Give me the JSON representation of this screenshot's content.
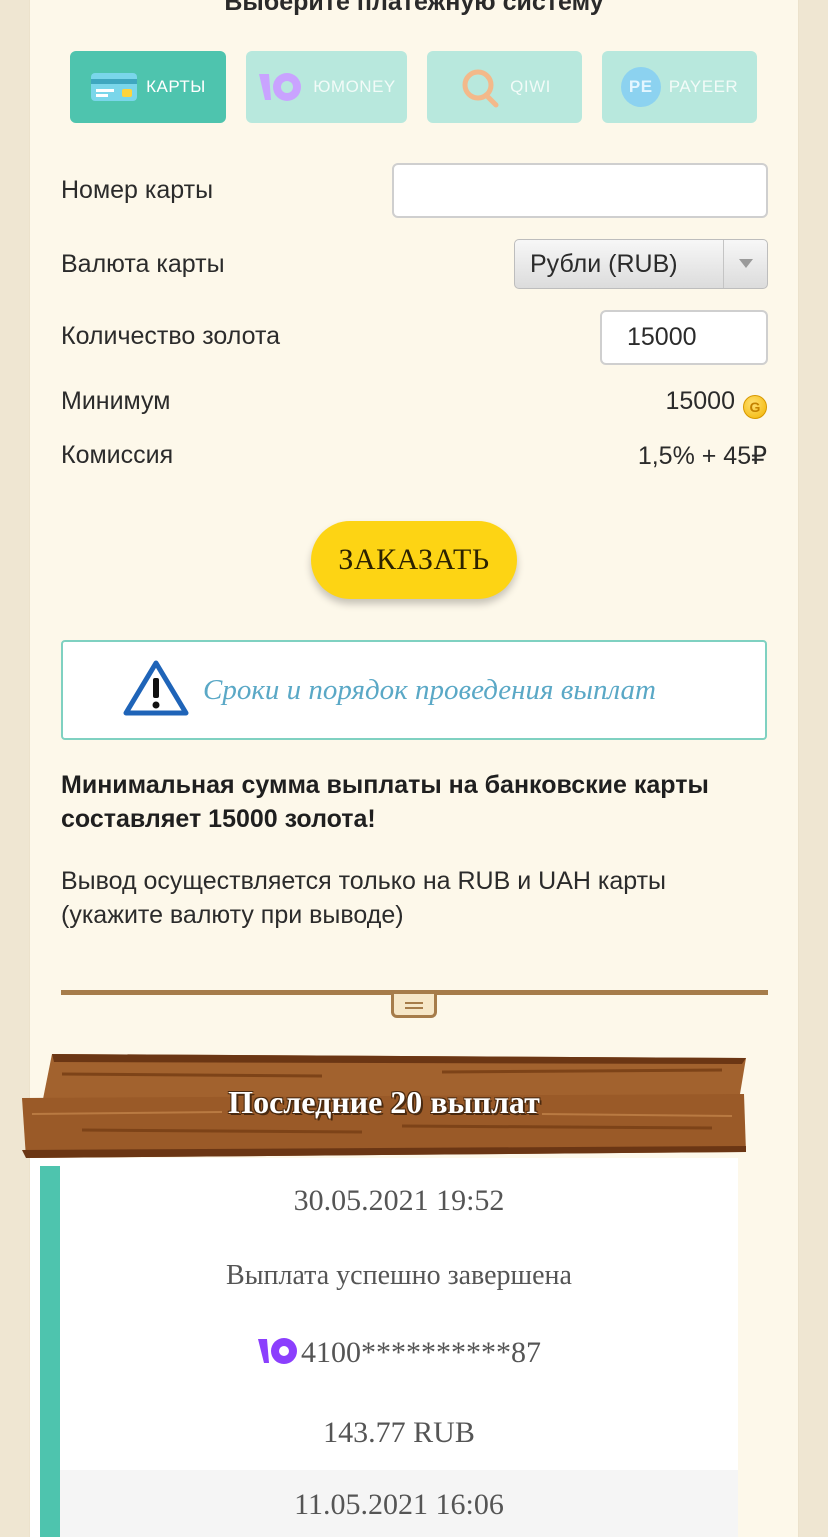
{
  "header": {
    "title": "Выберите платежную систему"
  },
  "payment_tabs": [
    {
      "label": "КАРТЫ",
      "icon": "credit-card-icon",
      "active": true
    },
    {
      "label": "ЮMONEY",
      "icon": "yoomoney-icon",
      "active": false
    },
    {
      "label": "QIWI",
      "icon": "qiwi-icon",
      "active": false
    },
    {
      "label": "PAYEER",
      "icon": "payeer-icon",
      "icon_text": "PE",
      "active": false
    }
  ],
  "form": {
    "card_number_label": "Номер карты",
    "card_number_value": "",
    "currency_label": "Валюта карты",
    "currency_selected": "Рубли (RUB)",
    "gold_amount_label": "Количество золота",
    "gold_amount_value": "15000",
    "minimum_label": "Минимум",
    "minimum_value": "15000",
    "coin_glyph": "G",
    "commission_label": "Комиссия",
    "commission_value": "1,5% + 45₽",
    "order_button": "ЗАКАЗАТЬ"
  },
  "terms_link": "Сроки и порядок проведения выплат",
  "notes": {
    "bold": "Минимальная сумма выплаты на банковские карты составляет 15000 золота!",
    "regular": "Вывод осуществляется только на RUB и UAH карты (укажите валюту при выводе)"
  },
  "payouts_section": {
    "title": "Последние 20 выплат",
    "items": [
      {
        "datetime": "30.05.2021 19:52",
        "status": "Выплата успешно завершена",
        "account": "4100**********87",
        "amount": "143.77 RUB",
        "method_icon": "yoomoney-icon"
      },
      {
        "datetime": "11.05.2021 16:06"
      }
    ]
  },
  "colors": {
    "accent_teal": "#4ec4ae",
    "button_yellow": "#fdd414",
    "yoomoney_purple": "#8b3ffd",
    "wood_brown": "#a0602c"
  }
}
